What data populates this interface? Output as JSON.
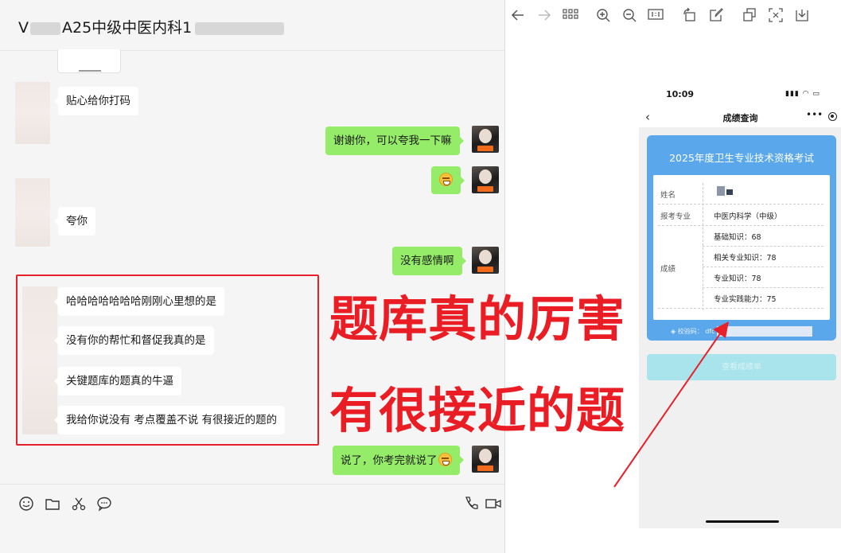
{
  "chat": {
    "title_prefix": "V",
    "title_mid": "A25中级中医内科1",
    "messages": [
      {
        "from": "other",
        "text": "贴心给你打码"
      },
      {
        "from": "self",
        "text": "谢谢你，可以夸我一下嘛"
      },
      {
        "from": "self",
        "text": "",
        "emoji": "face-emoji"
      },
      {
        "from": "other",
        "text": "夸你"
      },
      {
        "from": "self",
        "text": "没有感情啊"
      },
      {
        "from": "other",
        "text": "哈哈哈哈哈哈哈刚刚心里想的是"
      },
      {
        "from": "other",
        "text": "没有你的帮忙和督促我真的是"
      },
      {
        "from": "other",
        "text": "关键题库的题真的牛逼"
      },
      {
        "from": "other",
        "text": "我给你说没有 考点覆盖不说 有很接近的题的"
      },
      {
        "from": "self",
        "text": "说了，你考完就说了",
        "emoji": "grin-emoji"
      }
    ],
    "toolbar_icons": [
      "emoji-icon",
      "folder-icon",
      "scissors-icon",
      "chat-icon",
      "phone-icon",
      "video-icon"
    ]
  },
  "captions": {
    "line1": "题库真的厉害",
    "line2": "有很接近的题"
  },
  "viewer": {
    "toolbar_icons": [
      "back-arrow-icon",
      "forward-arrow-icon",
      "grid-icon",
      "zoom-in-icon",
      "zoom-out-icon",
      "actual-size-icon",
      "rotate-icon",
      "edit-icon",
      "copy-icon",
      "scan-icon",
      "download-icon"
    ],
    "phone": {
      "time": "10:09",
      "page_title": "成绩查询",
      "card_title": "2025年度卫生专业技术资格考试",
      "labels": {
        "name": "姓名",
        "major": "报考专业",
        "score": "成绩"
      },
      "major_value": "中医内科学（中级）",
      "scores": [
        {
          "subject": "基础知识：",
          "value": "68"
        },
        {
          "subject": "相关专业知识：",
          "value": "78"
        },
        {
          "subject": "专业知识：",
          "value": "78"
        },
        {
          "subject": "专业实践能力：",
          "value": "75"
        }
      ],
      "verify_label": "校验码：",
      "verify_partial": "dfc",
      "button_label": "查看成绩单"
    }
  },
  "colors": {
    "self_bubble": "#95ec69",
    "caption_red": "#ea1d25",
    "card_blue": "#5aa8eb"
  }
}
